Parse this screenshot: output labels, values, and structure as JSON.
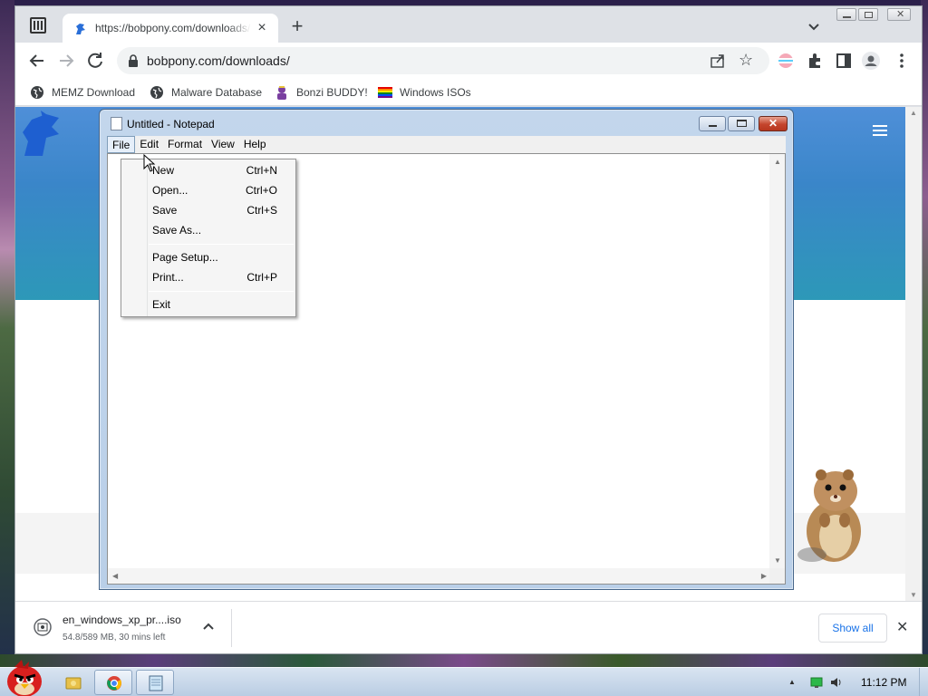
{
  "browser": {
    "tab_title": "https://bobpony.com/downloads/",
    "tab_close": "×",
    "new_tab": "+",
    "omnibox_url": "bobpony.com/downloads/",
    "bookmarks": [
      {
        "label": "MEMZ Download",
        "icon": "globe-icon"
      },
      {
        "label": "Malware Database",
        "icon": "globe-icon"
      },
      {
        "label": "Bonzi BUDDY!",
        "icon": "bonzi-icon"
      },
      {
        "label": "Windows ISOs",
        "icon": "rainbow-flag-icon"
      }
    ]
  },
  "notepad": {
    "title": "Untitled - Notepad",
    "close_glyph": "✕",
    "menus": [
      "File",
      "Edit",
      "Format",
      "View",
      "Help"
    ],
    "open_menu": "File",
    "file_menu": [
      {
        "label": "New",
        "shortcut": "Ctrl+N"
      },
      {
        "label": "Open...",
        "shortcut": "Ctrl+O"
      },
      {
        "label": "Save",
        "shortcut": "Ctrl+S"
      },
      {
        "label": "Save As...",
        "shortcut": ""
      },
      {
        "label": "Page Setup...",
        "shortcut": ""
      },
      {
        "label": "Print...",
        "shortcut": "Ctrl+P"
      },
      {
        "label": "Exit",
        "shortcut": ""
      }
    ]
  },
  "download": {
    "filename": "en_windows_xp_pr....iso",
    "status": "54.8/589 MB, 30 mins left",
    "show_all": "Show all",
    "close": "✕"
  },
  "taskbar": {
    "clock": "11:12 PM",
    "apps": [
      "explorer-icon",
      "chrome-icon",
      "notepad-icon"
    ]
  },
  "colors": {
    "hero_blue": "#3a86c9",
    "link_blue": "#1a73e8",
    "notepad_frame": "#b9cfe8",
    "close_red": "#c4452c"
  }
}
